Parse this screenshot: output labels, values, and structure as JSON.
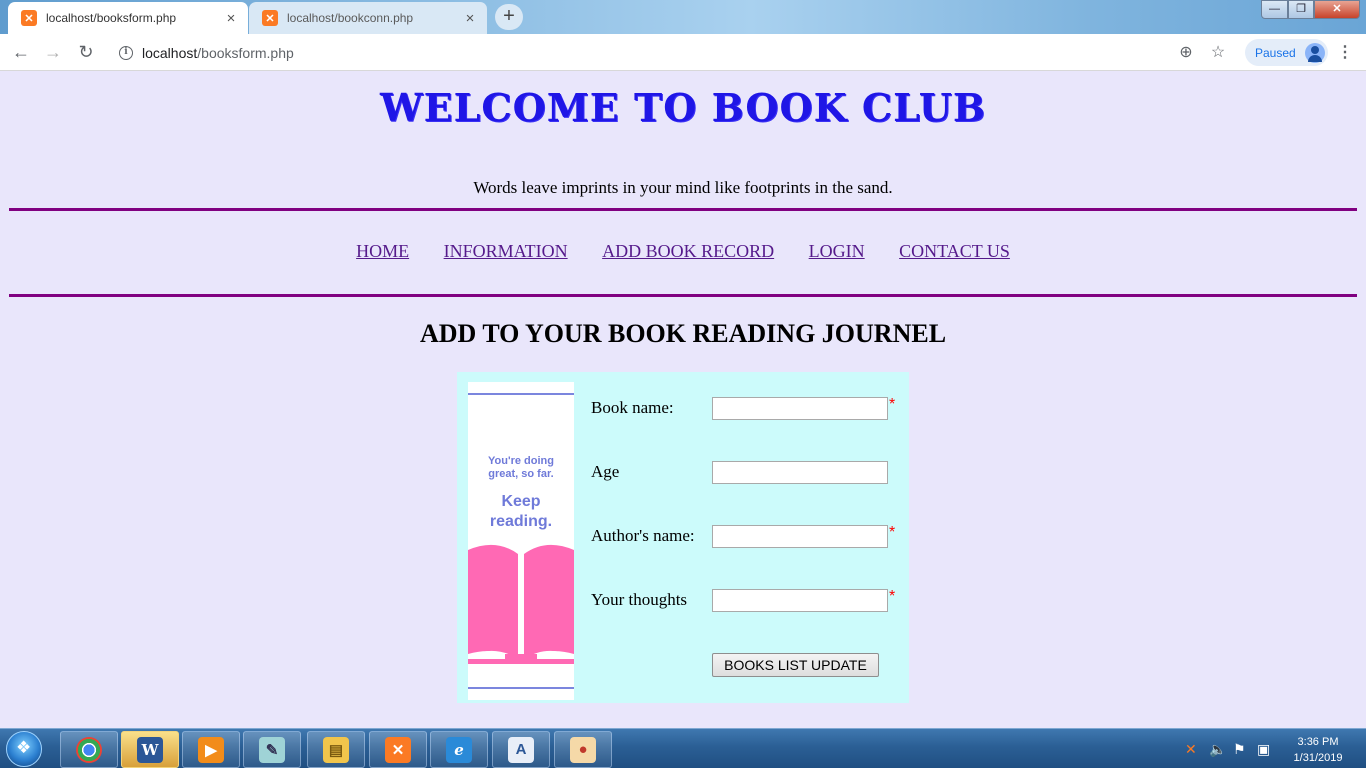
{
  "browser": {
    "tabs": [
      {
        "title": "localhost/booksform.php",
        "active": true
      },
      {
        "title": "localhost/bookconn.php",
        "active": false
      }
    ],
    "new_tab_symbol": "+",
    "tab_close_symbol": "×",
    "url_host": "localhost",
    "url_path": "/booksform.php",
    "profile_status": "Paused",
    "icons": [
      "back-icon",
      "forward-icon",
      "reload-icon",
      "info-icon",
      "zoom-icon",
      "star-icon",
      "avatar-icon",
      "menu-icon"
    ]
  },
  "page": {
    "heading": "WELCOME TO BOOK CLUB",
    "tagline": "Words leave imprints in your mind like footprints in the sand.",
    "nav": [
      "HOME",
      "INFORMATION",
      "ADD BOOK RECORD",
      "LOGIN",
      "CONTACT US"
    ],
    "form_title": "ADD TO YOUR BOOK READING JOURNEL",
    "poster": {
      "subtitle_line1": "You're doing",
      "subtitle_line2": "great, so far.",
      "main_line1": "Keep",
      "main_line2": "reading."
    },
    "form": {
      "fields": [
        {
          "label": "Book name:",
          "value": "",
          "required": true
        },
        {
          "label": "Age",
          "value": "",
          "required": false
        },
        {
          "label": "Author's name:",
          "value": "",
          "required": true
        },
        {
          "label": "Your thoughts",
          "value": "",
          "required": true
        }
      ],
      "required_mark": "*",
      "submit_label": "BOOKS LIST UPDATE"
    }
  },
  "taskbar": {
    "apps": [
      "chrome-icon",
      "word-icon",
      "media-player-icon",
      "notepad-icon",
      "file-explorer-icon",
      "xampp-icon",
      "internet-explorer-icon",
      "wordpad-icon",
      "paint-icon"
    ],
    "time": "3:36 PM",
    "date": "1/31/2019"
  },
  "colors": {
    "page_bg": "#e9e6fb",
    "heading": "#1f16e6",
    "rule": "#800080",
    "nav_link": "#551a8b",
    "form_bg": "#ccfbfb",
    "poster_accent": "#6f7ad9",
    "poster_book": "#ff69b4",
    "required": "#ff0000"
  }
}
